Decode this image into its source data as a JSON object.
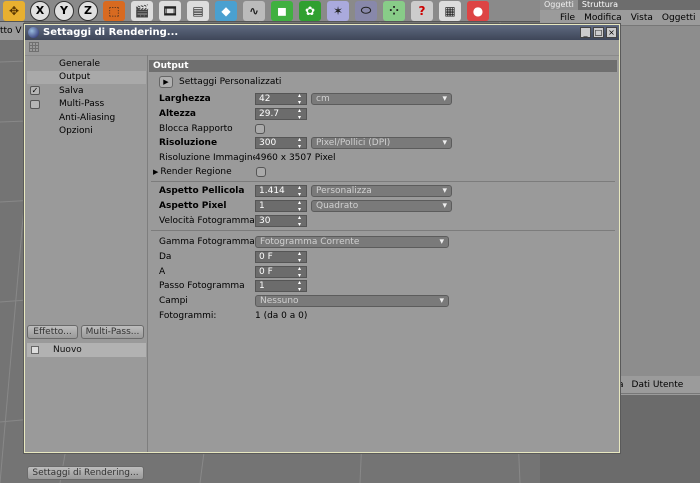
{
  "toolbar": {
    "axis_x": "X",
    "axis_y": "Y",
    "axis_z": "Z",
    "icons": [
      "move-icon",
      "x-axis-icon",
      "y-axis-icon",
      "z-axis-icon",
      "coordinate-icon",
      "clapper-icon",
      "render-view-icon",
      "render-settings-icon",
      "cube-icon",
      "spline-icon",
      "nurbs-icon",
      "modeling-icon",
      "deformer-icon",
      "scene-icon",
      "light-icon",
      "tag-icon",
      "help-icon",
      "calendar-icon",
      "globe-icon"
    ]
  },
  "left_edge": {
    "text": "tto  V"
  },
  "right_panel": {
    "tabs": [
      "Oggetti",
      "Struttura"
    ],
    "menu": [
      "File",
      "Modifica",
      "Vista",
      "Oggetti"
    ],
    "bottom_header": [
      "a",
      "Dati Utente"
    ]
  },
  "dialog": {
    "title": "Settaggi di Rendering...",
    "nav": [
      {
        "label": "Generale",
        "check": false,
        "checked": false,
        "selected": false
      },
      {
        "label": "Output",
        "check": false,
        "checked": false,
        "selected": true
      },
      {
        "label": "Salva",
        "check": true,
        "checked": true,
        "selected": false
      },
      {
        "label": "Multi-Pass",
        "check": true,
        "checked": false,
        "selected": false
      },
      {
        "label": "Anti-Aliasing",
        "check": false,
        "checked": false,
        "selected": false
      },
      {
        "label": "Opzioni",
        "check": false,
        "checked": false,
        "selected": false
      }
    ],
    "effetto_button": "Effetto...",
    "multipass_button": "Multi-Pass...",
    "new_item": "Nuovo",
    "settings_button": "Settaggi di Rendering...",
    "section_title": "Output",
    "preset_label": "Settaggi Personalizzati",
    "fields": {
      "larghezza": {
        "label": "Larghezza",
        "value": "42",
        "unit": "cm"
      },
      "altezza": {
        "label": "Altezza",
        "value": "29.7"
      },
      "blocca": {
        "label": "Blocca Rapporto"
      },
      "risoluzione": {
        "label": "Risoluzione",
        "value": "300",
        "unit": "Pixel/Pollici (DPI)"
      },
      "risoluzione_immagine": {
        "label": "Risoluzione Immagine:",
        "value": "4960 x 3507 Pixel"
      },
      "render_regione": {
        "label": "Render Regione"
      },
      "aspetto_pellicola": {
        "label": "Aspetto Pellicola",
        "value": "1.414",
        "preset": "Personalizza"
      },
      "aspetto_pixel": {
        "label": "Aspetto Pixel",
        "value": "1",
        "preset": "Quadrato"
      },
      "velocita": {
        "label": "Velocità Fotogramma",
        "value": "30"
      },
      "gamma": {
        "label": "Gamma Fotogramma",
        "value": "Fotogramma Corrente"
      },
      "da": {
        "label": "Da",
        "value": "0 F"
      },
      "a": {
        "label": "A",
        "value": "0 F"
      },
      "passo": {
        "label": "Passo Fotogramma",
        "value": "1"
      },
      "campi": {
        "label": "Campi",
        "value": "Nessuno"
      },
      "fotogrammi": {
        "label": "Fotogrammi:",
        "value": "1 (da 0 a 0)"
      }
    }
  }
}
